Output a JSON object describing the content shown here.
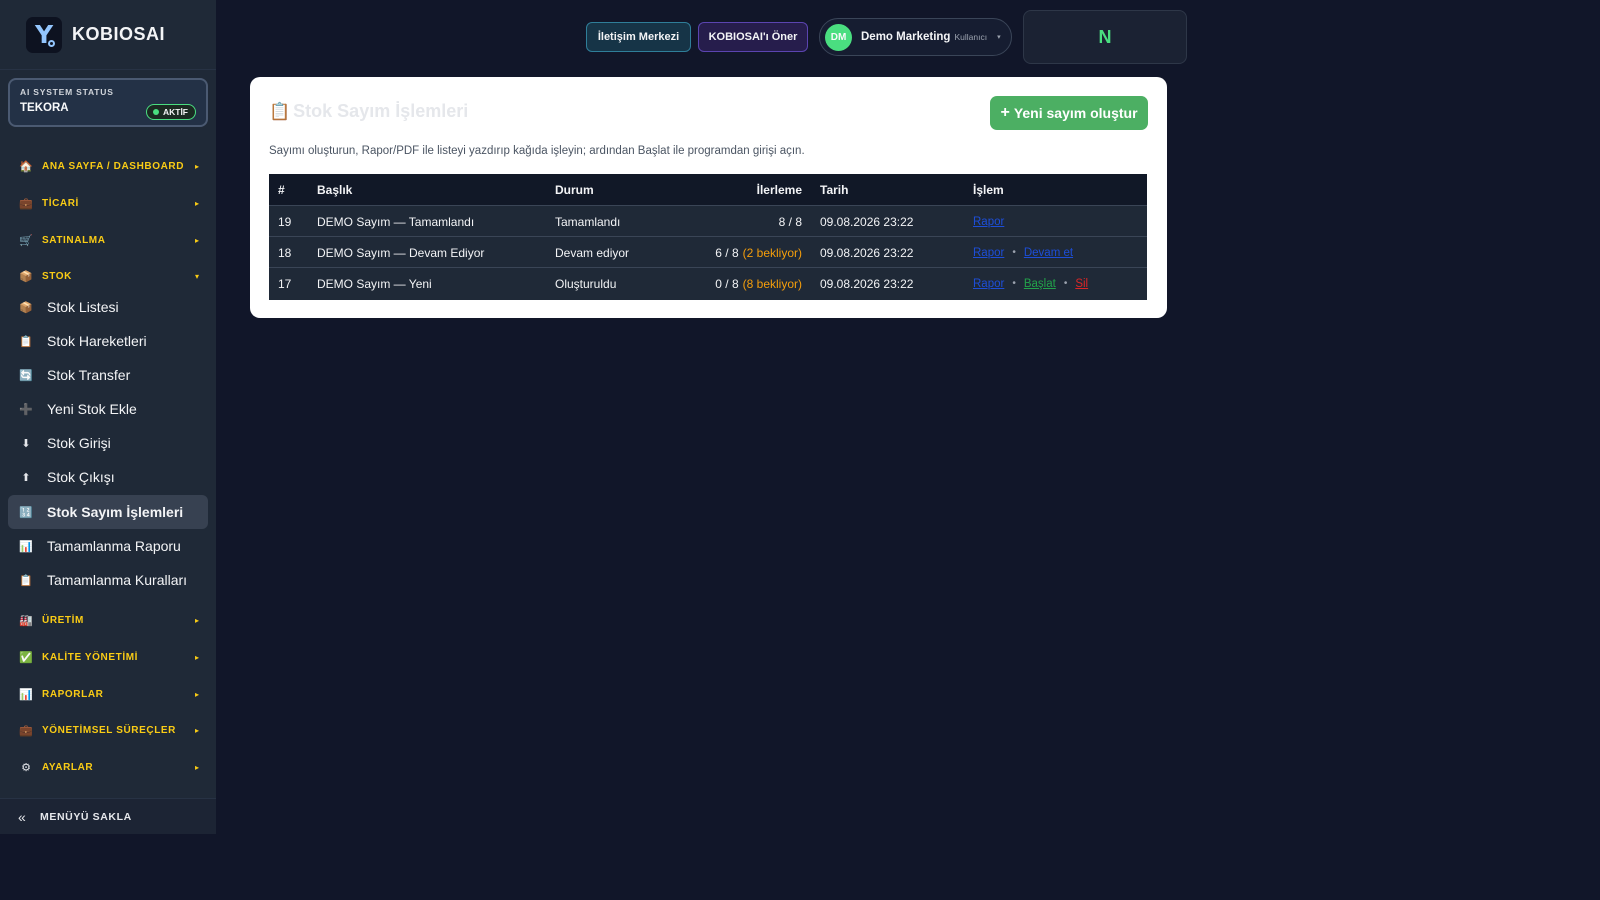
{
  "brand": {
    "name": "KOBIOSAI",
    "logo_letter": "Y"
  },
  "system_status": {
    "title": "AI SYSTEM STATUS",
    "name": "TEKORA",
    "badge": "AKTİF"
  },
  "sidebar": {
    "sections": [
      {
        "label": "ANA SAYFA / DASHBOARD",
        "icon": "🏠",
        "icon_name": "home-icon",
        "arrow": "▸"
      },
      {
        "label": "TİCARİ",
        "icon": "💼",
        "icon_name": "briefcase-icon",
        "arrow": "▸"
      },
      {
        "label": "SATINALMA",
        "icon": "🛒",
        "icon_name": "cart-icon",
        "arrow": "▸"
      },
      {
        "label": "STOK",
        "icon": "📦",
        "icon_name": "box-icon",
        "arrow": "▾"
      },
      {
        "label": "ÜRETİM",
        "icon": "🏭",
        "icon_name": "factory-icon",
        "arrow": "▸"
      },
      {
        "label": "KALİTE YÖNETİMİ",
        "icon": "✅",
        "icon_name": "check-icon",
        "arrow": "▸"
      },
      {
        "label": "RAPORLAR",
        "icon": "📊",
        "icon_name": "chart-icon",
        "arrow": "▸"
      },
      {
        "label": "YÖNETİMSEL SÜREÇLER",
        "icon": "💼",
        "icon_name": "briefcase-icon",
        "arrow": "▸"
      },
      {
        "label": "AYARLAR",
        "icon": "⚙",
        "icon_name": "gear-icon",
        "arrow": "▸"
      }
    ],
    "stok_items": [
      {
        "label": "Stok Listesi",
        "icon": "📦",
        "icon_name": "box-icon"
      },
      {
        "label": "Stok Hareketleri",
        "icon": "📋",
        "icon_name": "clipboard-icon"
      },
      {
        "label": "Stok Transfer",
        "icon": "🔄",
        "icon_name": "transfer-icon"
      },
      {
        "label": "Yeni Stok Ekle",
        "icon": "➕",
        "icon_name": "plus-icon"
      },
      {
        "label": "Stok Girişi",
        "icon": "⬇",
        "icon_name": "arrow-down-icon"
      },
      {
        "label": "Stok Çıkışı",
        "icon": "⬆",
        "icon_name": "arrow-up-icon"
      },
      {
        "label": "Stok Sayım İşlemleri",
        "icon": "🔢",
        "icon_name": "numbers-icon",
        "active": true
      },
      {
        "label": "Tamamlanma Raporu",
        "icon": "📊",
        "icon_name": "chart-icon"
      },
      {
        "label": "Tamamlanma Kuralları",
        "icon": "📋",
        "icon_name": "clipboard-icon"
      }
    ],
    "footer": {
      "label": "MENÜYÜ SAKLA",
      "icon": "«"
    }
  },
  "topbar": {
    "contact_label": "İletişim Merkezi",
    "suggest_label": "KOBIOSAI'ı Öner",
    "user": {
      "initials": "DM",
      "name": "Demo Marketing",
      "role": "Kullanıcı",
      "caret": "▾"
    },
    "notif_letter": "N"
  },
  "page": {
    "title_icon": "📋",
    "title": "Stok Sayım İşlemleri",
    "new_button": "Yeni sayım oluştur",
    "new_button_icon": "+",
    "description": "Sayımı oluşturun, Rapor/PDF ile listeyi yazdırıp kağıda işleyin; ardından Başlat ile programdan girişi açın.",
    "columns": [
      "#",
      "Başlık",
      "Durum",
      "İlerleme",
      "Tarih",
      "İşlem"
    ],
    "rows": [
      {
        "id": "19",
        "title": "DEMO Sayım — Tamamlandı",
        "status": "Tamamlandı",
        "progress": "8 / 8",
        "pending": "",
        "date": "09.08.2026 23:22",
        "actions": [
          {
            "label": "Rapor",
            "style": "blue"
          }
        ]
      },
      {
        "id": "18",
        "title": "DEMO Sayım — Devam Ediyor",
        "status": "Devam ediyor",
        "progress": "6 / 8",
        "pending": "(2 bekliyor)",
        "date": "09.08.2026 23:22",
        "actions": [
          {
            "label": "Rapor",
            "style": "blue"
          },
          {
            "label": "Devam et",
            "style": "blue"
          }
        ]
      },
      {
        "id": "17",
        "title": "DEMO Sayım — Yeni",
        "status": "Oluşturuldu",
        "progress": "0 / 8",
        "pending": "(8 bekliyor)",
        "date": "09.08.2026 23:22",
        "actions": [
          {
            "label": "Rapor",
            "style": "blue"
          },
          {
            "label": "Başlat",
            "style": "green"
          },
          {
            "label": "Sil",
            "style": "red"
          }
        ]
      }
    ],
    "action_separator": "•"
  }
}
